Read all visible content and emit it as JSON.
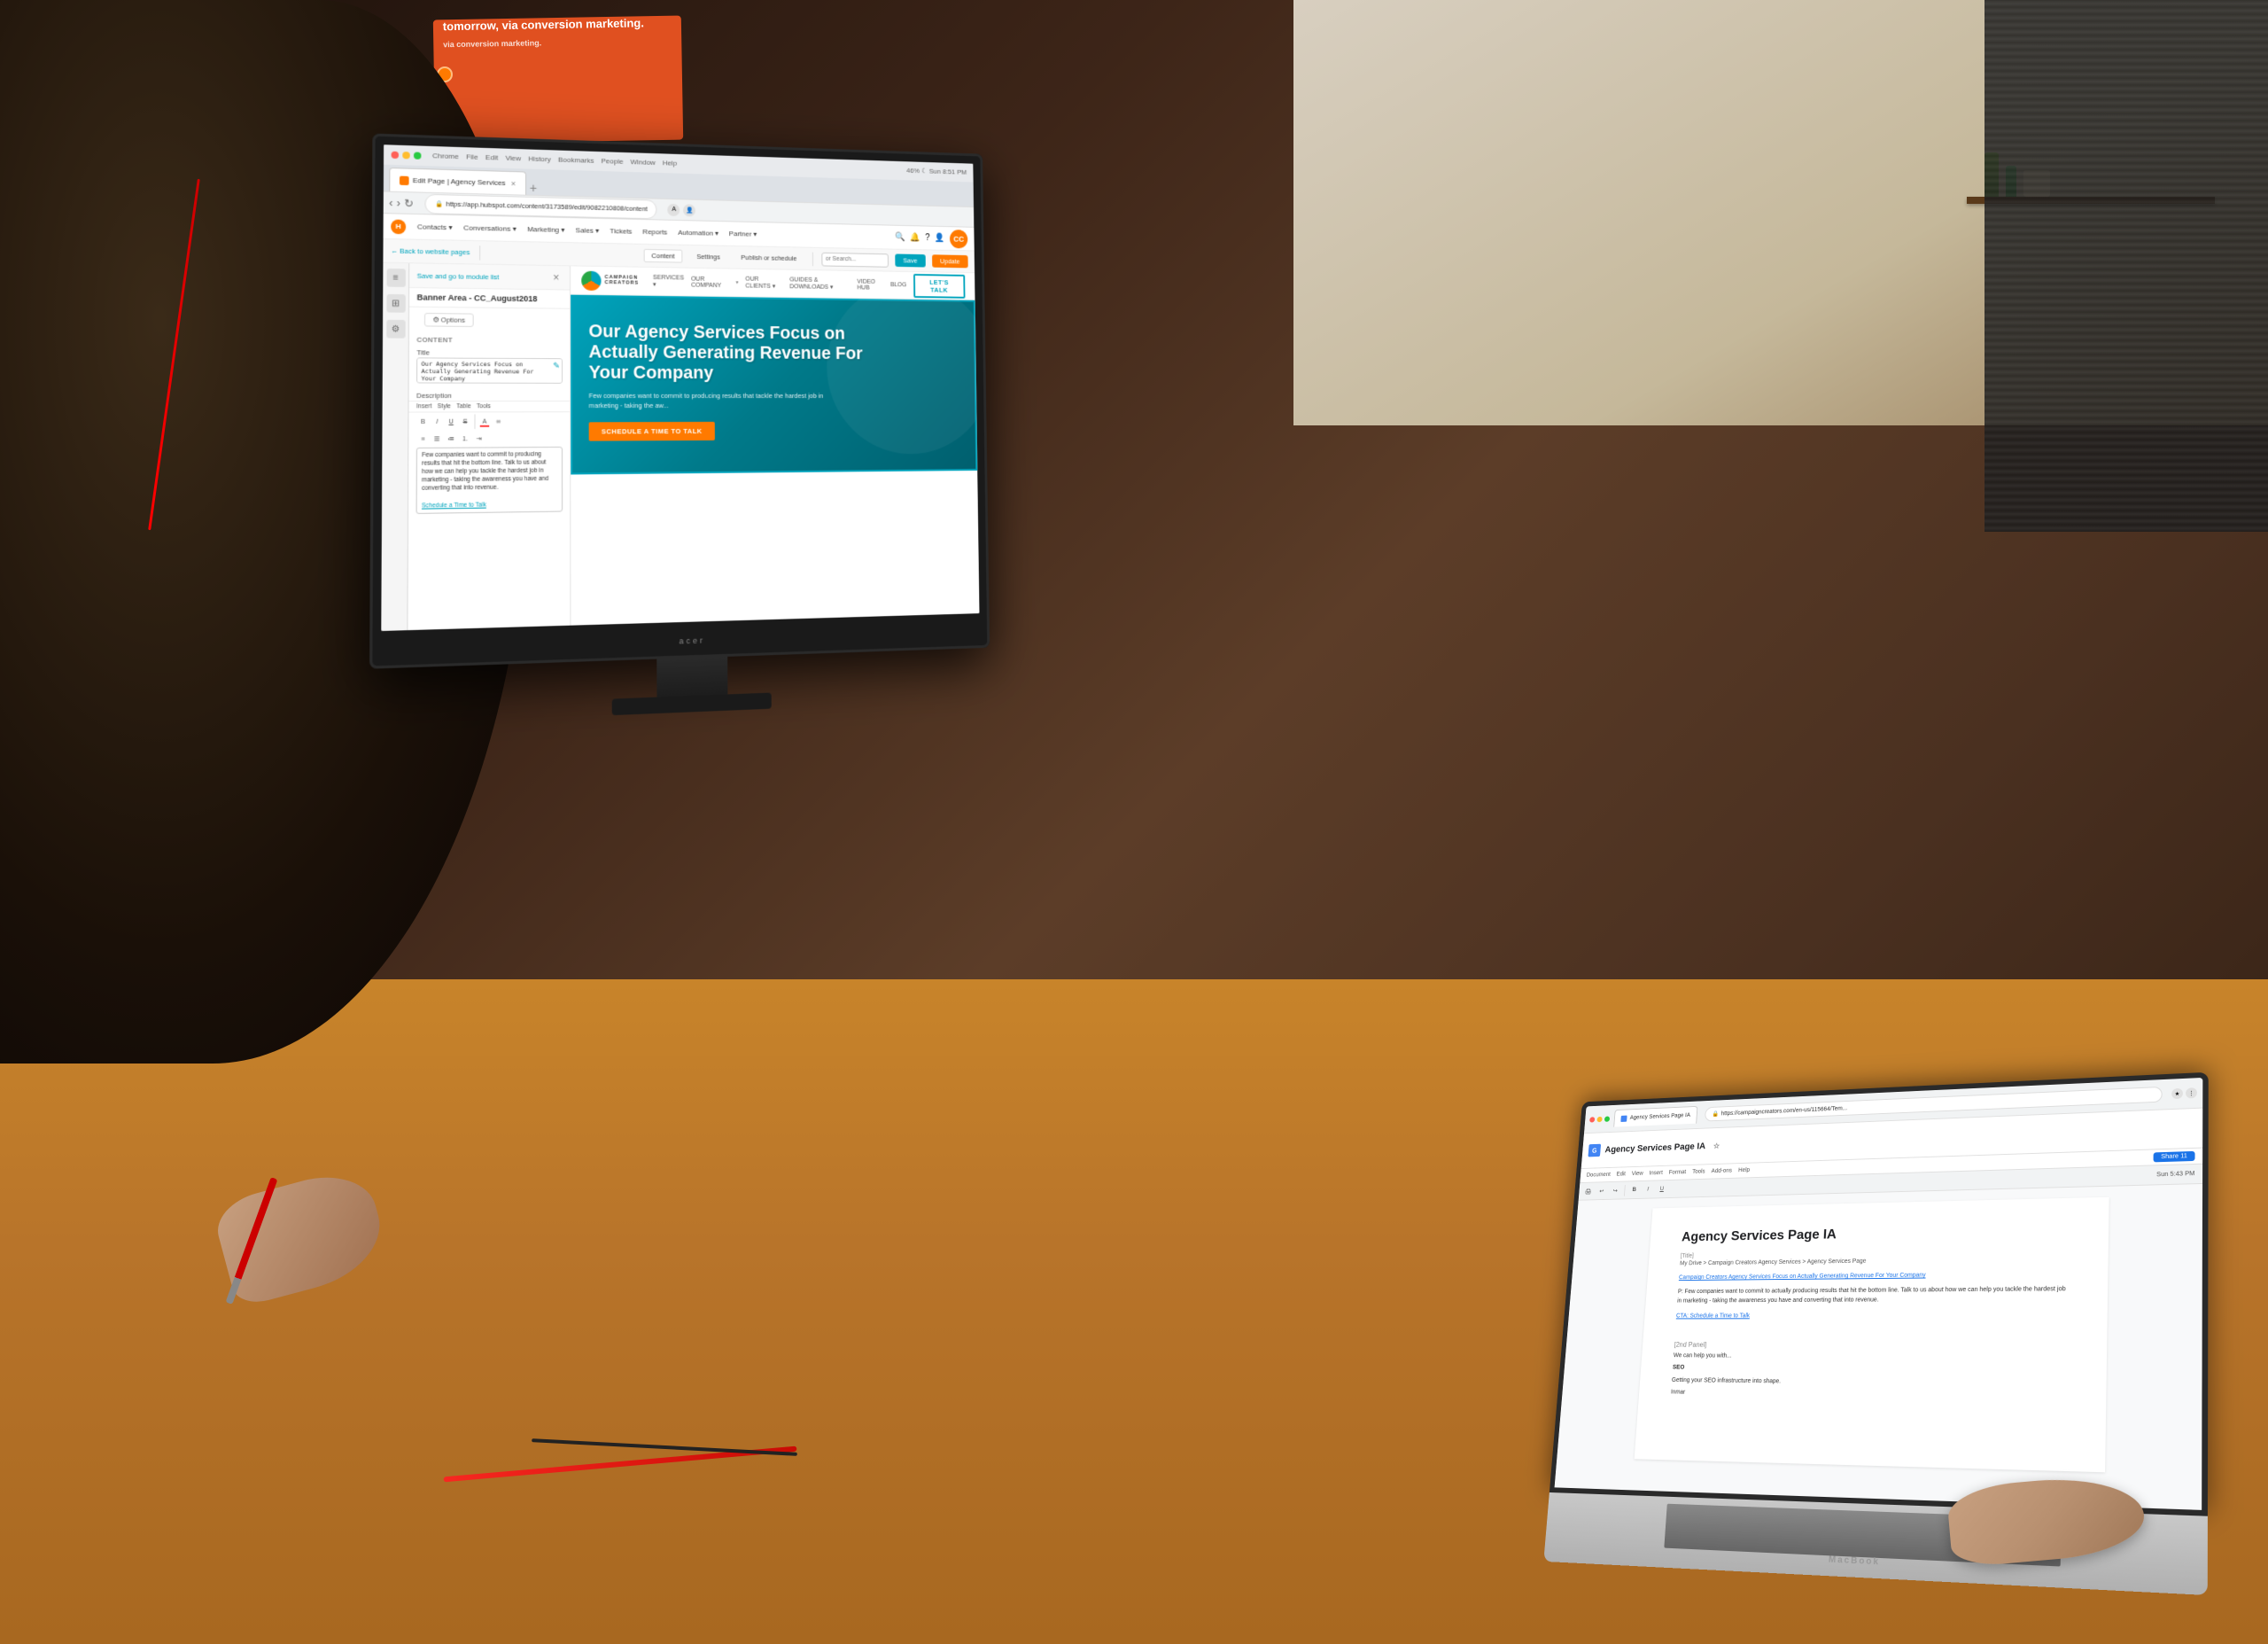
{
  "background": {
    "desc": "Office workspace with person editing website on dual screens"
  },
  "wall": {
    "orange_card_text": "tomorrow, via conversion marketing.",
    "brand_text": "Campaign Creators"
  },
  "monitor": {
    "browser": {
      "tab_label": "Edit Page | Agency Services",
      "url": "https://app.hubspot.com/content/3173589/edit/9082210808/content",
      "menu_items": [
        "Chrome",
        "File",
        "Edit",
        "View",
        "History",
        "Bookmarks",
        "People",
        "Window",
        "Help"
      ]
    },
    "hs_nav": {
      "logo_letter": "H",
      "items": [
        "Contacts",
        "Conversations",
        "Marketing",
        "Sales",
        "Tickets",
        "Reports",
        "Automation",
        "Partner"
      ],
      "reports_label": "Reports"
    },
    "hs_toolbar": {
      "back_link": "← Back to website pages",
      "tabs": [
        "Content",
        "Settings",
        "Publish or schedule"
      ],
      "active_tab": "Content",
      "search_placeholder": "or Search...",
      "save_label": "Save",
      "update_label": "Update"
    },
    "hs_panel": {
      "close_btn": "×",
      "back_link": "Save and go to module list",
      "module_title": "Banner Area - CC_August2018",
      "options_tab": "⚙ Options",
      "content_label": "Content",
      "title_label": "Title",
      "title_value": "Our Agency Services Focus on Actually Generating Revenue For Your Company",
      "description_label": "Description",
      "rte_toolbar": [
        "Insert",
        "Style",
        "Table",
        "Tools"
      ],
      "rte_buttons": [
        "B",
        "I",
        "U",
        "S",
        "A",
        "∞"
      ],
      "body_text": "Few companies want to commit to producing results that hit the bottom line. Talk to us about how we can help you tackle the hardest job in marketing - taking the awareness you have and converting that into revenue.",
      "link_text": "Schedule a Time to Talk",
      "edit_icon": "✎"
    },
    "preview": {
      "nav": {
        "logo_text": "CAMPAIGN\nCREATORS",
        "items": [
          "SERVICES",
          "OUR COMPANY",
          "OUR CLIENTS",
          "GUIDES & DOWNLOADS",
          "VIDEO HUB",
          "BLOG"
        ],
        "our_company": "OUR COMPANY",
        "cta_label": "LET'S TALK"
      },
      "hero": {
        "title": "Our Agency Services Focus on Actually Generating Revenue For Your Company",
        "subtitle": "Few companies want to commit to producing results that tackle the hardest job in marketing - taking the aw...",
        "cta_label": "SCHEDULE A TIME TO TALK"
      }
    }
  },
  "laptop": {
    "browser": {
      "tab_label": "Agency Services Page IA",
      "url": "https://campaigncreators.com/en-us/115664/Tem...",
      "share_btn": "Share 11"
    },
    "doc": {
      "icon": "G",
      "title": "Agency Services Page IA",
      "menu_items": [
        "Document",
        "Edit",
        "View",
        "Insert",
        "Format",
        "Tools",
        "Add-ons",
        "Help"
      ],
      "breadcrumb": "My Drive > Campaign Creators Agency Services > Agency Services Page",
      "h1": "Agency Services Page IA",
      "content": {
        "title_label": "[Title]",
        "campaign_link": "Campaign Creators Agency Services Focus on Actually Generating Revenue For Your Company",
        "para1": "P: Few companies want to commit to actually producing results that hit the bottom line. Talk to us about how we can help you tackle the hardest job in marketing - taking the awareness you have and converting that into revenue.",
        "cta_text": "CTA: Schedule a Time to Talk",
        "panel_label": "[2nd Panel]",
        "help_text": "We can help you with...",
        "service1": "SEO",
        "service1_desc": "Getting your SEO infrastructure into shape.",
        "service_label": "Inmar"
      }
    }
  },
  "detected_text": {
    "edit_agency_services": "Edit Agency Services",
    "history": "History",
    "our_company": "ouR COMPANY",
    "reports": "Reports"
  }
}
